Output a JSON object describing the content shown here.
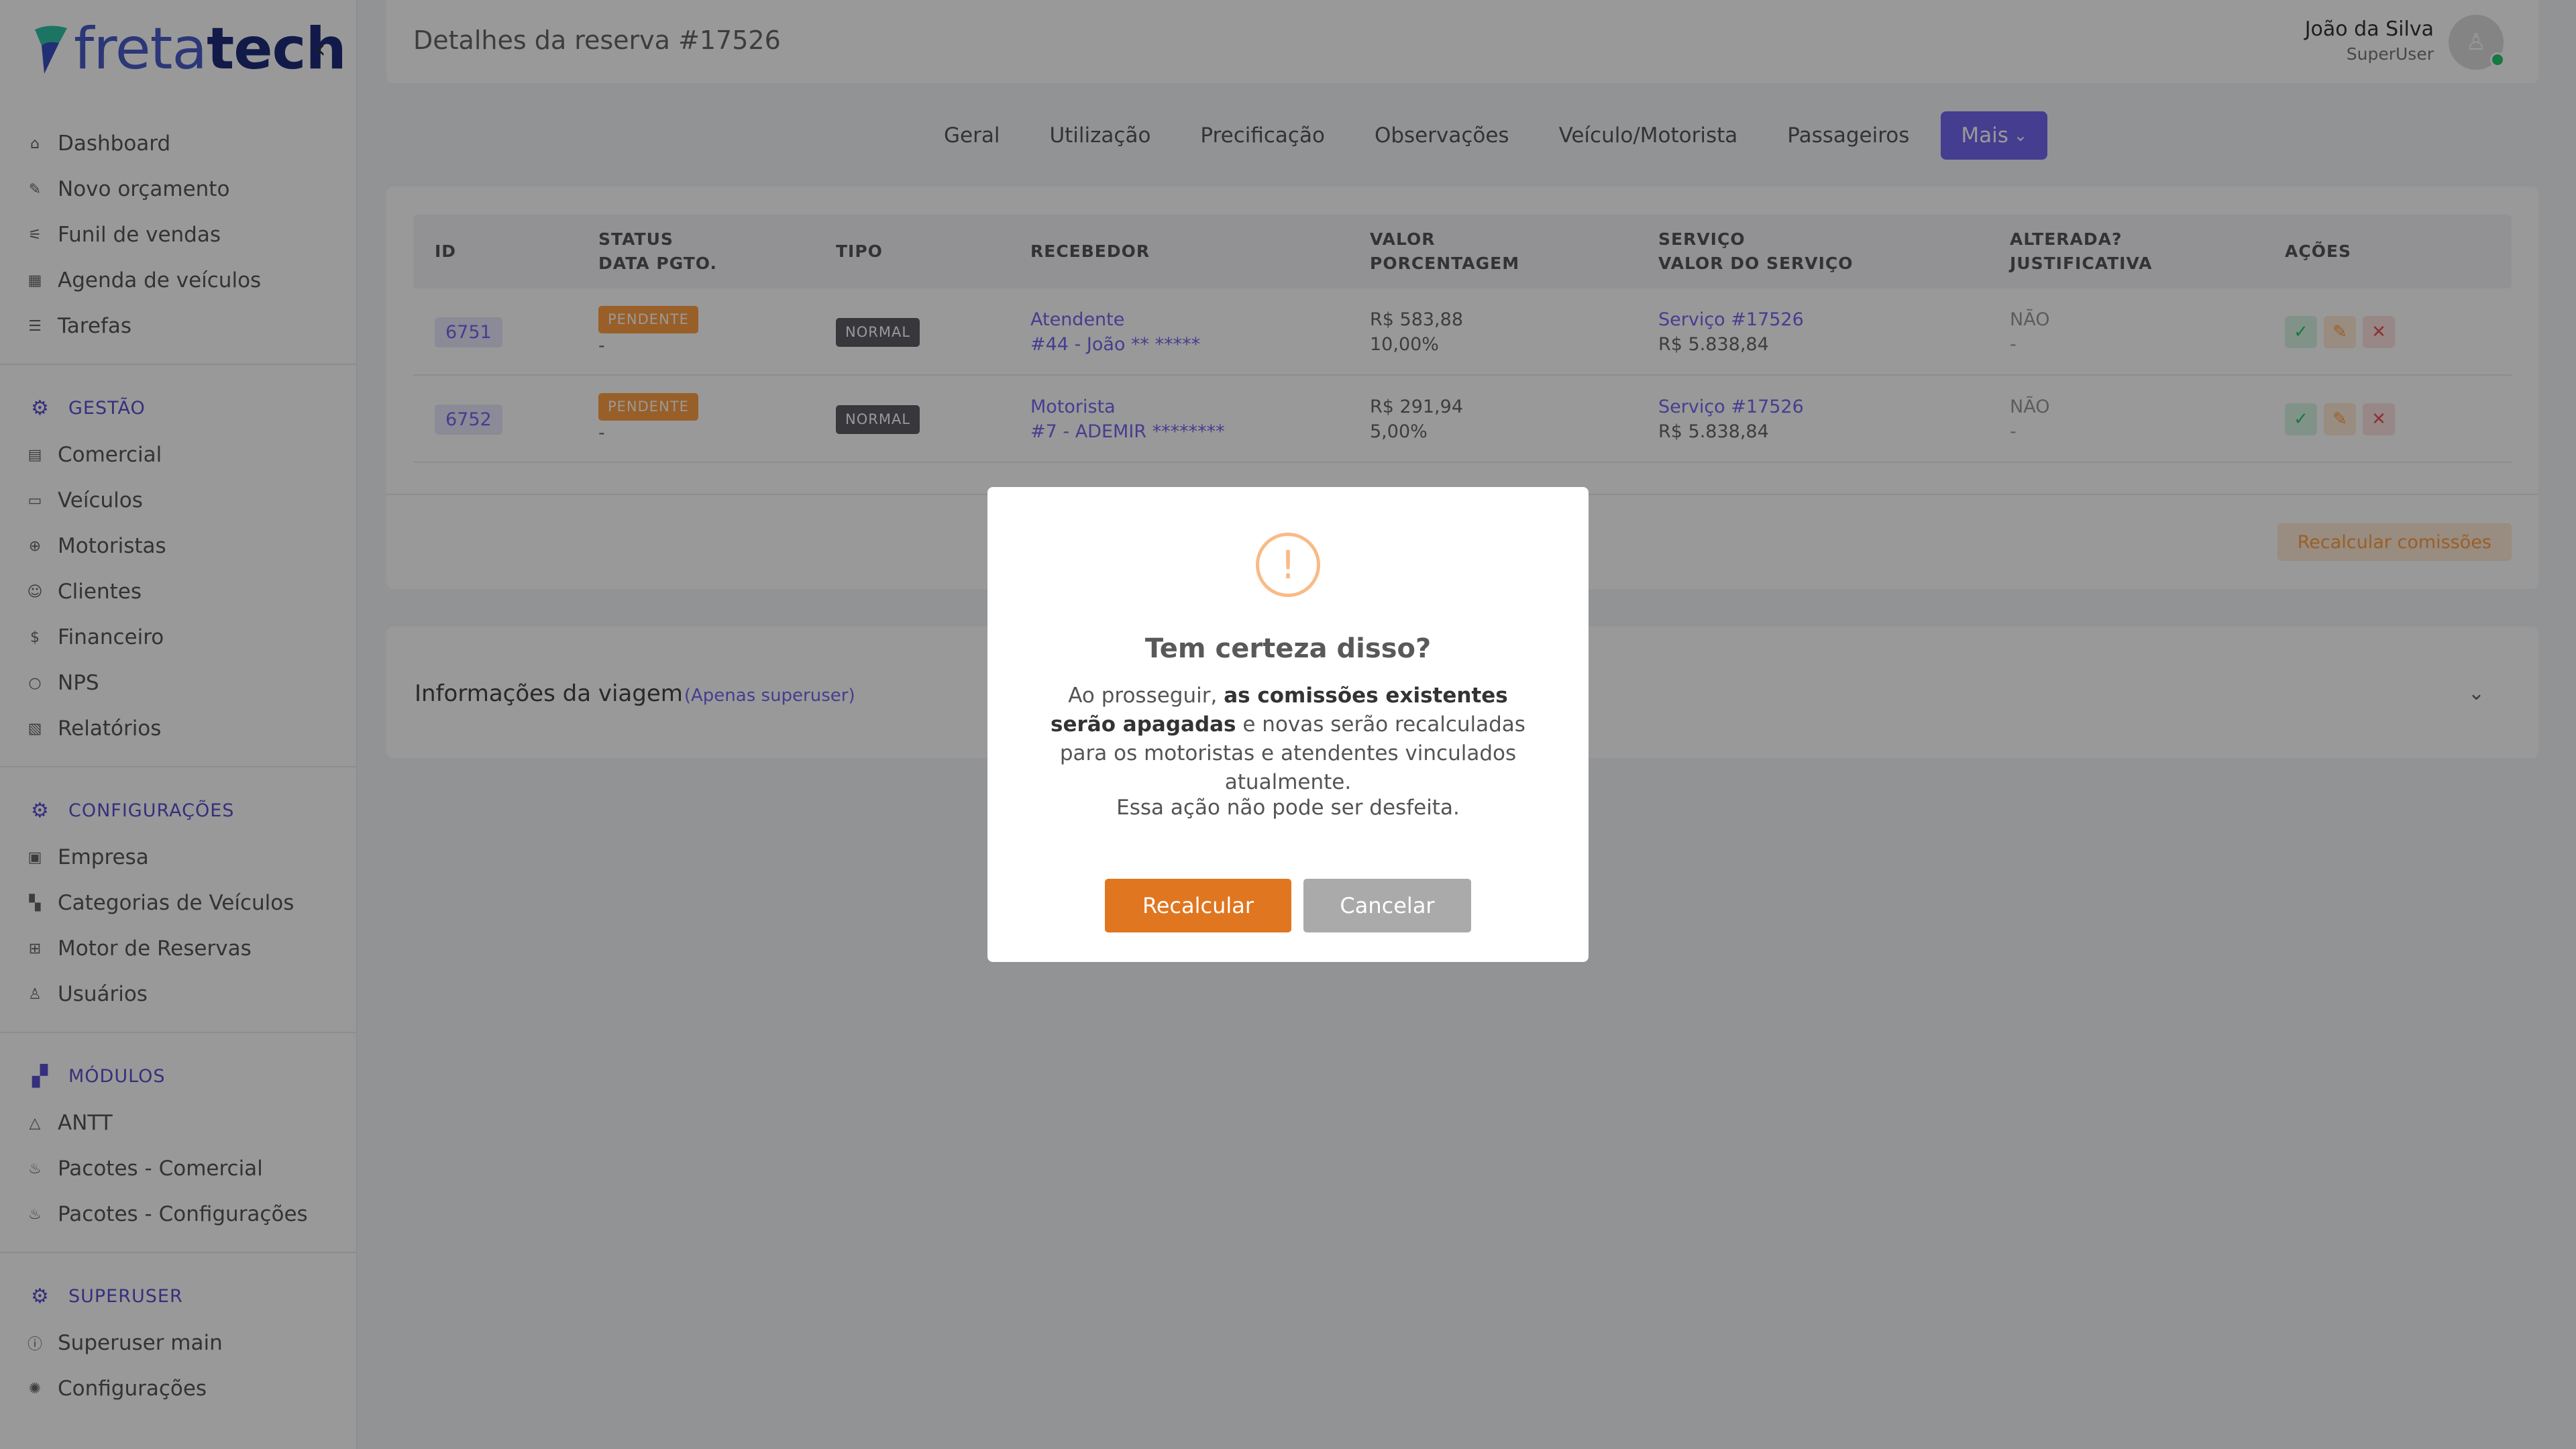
{
  "app": {
    "logo_a": "freta",
    "logo_b": "tech"
  },
  "sidebar": {
    "main_items": [
      {
        "label": "Dashboard",
        "icon": "home-icon"
      },
      {
        "label": "Novo orçamento",
        "icon": "edit-icon"
      },
      {
        "label": "Funil de vendas",
        "icon": "filter-icon"
      },
      {
        "label": "Agenda de veículos",
        "icon": "calendar-icon"
      },
      {
        "label": "Tarefas",
        "icon": "list-icon"
      }
    ],
    "sections": [
      {
        "title": "GESTÃO",
        "items": [
          "Comercial",
          "Veículos",
          "Motoristas",
          "Clientes",
          "Financeiro",
          "NPS",
          "Relatórios"
        ]
      },
      {
        "title": "CONFIGURAÇÕES",
        "items": [
          "Empresa",
          "Categorias de Veículos",
          "Motor de Reservas",
          "Usuários"
        ]
      },
      {
        "title": "MÓDULOS",
        "items": [
          "ANTT",
          "Pacotes - Comercial",
          "Pacotes - Configurações"
        ]
      },
      {
        "title": "SUPERUSER",
        "items": [
          "Superuser main",
          "Configurações"
        ]
      }
    ]
  },
  "header": {
    "title": "Detalhes da reserva #17526",
    "user_name": "João da Silva",
    "user_role": "SuperUser"
  },
  "tabs": [
    "Geral",
    "Utilização",
    "Precificação",
    "Observações",
    "Veículo/Motorista",
    "Passageiros",
    "Mais"
  ],
  "table": {
    "headers": [
      {
        "l1": "ID",
        "l2": ""
      },
      {
        "l1": "STATUS",
        "l2": "DATA PGTO."
      },
      {
        "l1": "TIPO",
        "l2": ""
      },
      {
        "l1": "RECEBEDOR",
        "l2": ""
      },
      {
        "l1": "VALOR",
        "l2": "PORCENTAGEM"
      },
      {
        "l1": "SERVIÇO",
        "l2": "VALOR DO SERVIÇO"
      },
      {
        "l1": "ALTERADA?",
        "l2": "JUSTIFICATIVA"
      },
      {
        "l1": "AÇÕES",
        "l2": ""
      }
    ],
    "rows": [
      {
        "id": "6751",
        "status": "PENDENTE",
        "data_pgto": "-",
        "tipo": "NORMAL",
        "recebedor_1": "Atendente",
        "recebedor_2": "#44 - João ** *****",
        "valor": "R$ 583,88",
        "porcentagem": "10,00%",
        "servico": "Serviço #17526",
        "valor_servico": "R$ 5.838,84",
        "alterada": "NÃO",
        "justificativa": "-"
      },
      {
        "id": "6752",
        "status": "PENDENTE",
        "data_pgto": "-",
        "tipo": "NORMAL",
        "recebedor_1": "Motorista",
        "recebedor_2": "#7 - ADEMIR ********",
        "valor": "R$ 291,94",
        "porcentagem": "5,00%",
        "servico": "Serviço #17526",
        "valor_servico": "R$ 5.838,84",
        "alterada": "NÃO",
        "justificativa": "-"
      }
    ],
    "recalc_label": "Recalcular comissões"
  },
  "info": {
    "title": "Informações da viagem",
    "subtitle": "(Apenas superuser)"
  },
  "modal": {
    "icon": "!",
    "title": "Tem certeza disso?",
    "text_before": "Ao prosseguir, ",
    "text_bold": "as comissões existentes serão apagadas",
    "text_after": " e novas serão recalculadas para os motoristas e atendentes vinculados atualmente.",
    "note": "Essa ação não pode ser desfeita.",
    "confirm_label": "Recalcular",
    "cancel_label": "Cancelar"
  },
  "colors": {
    "accent": "#7367f0",
    "confirm": "#e0761f",
    "warning": "#ff9f43"
  }
}
